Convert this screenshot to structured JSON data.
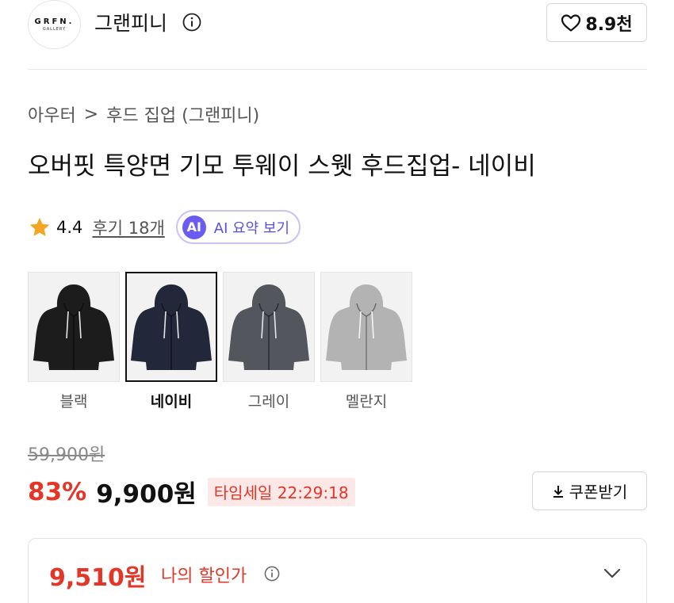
{
  "brand": {
    "logo_line1": "GRFN.",
    "logo_line2": "GALLERY",
    "name": "그랜피니",
    "like_count": "8.9천"
  },
  "breadcrumb": {
    "category": "아우터",
    "separator": ">",
    "subcategory": "후드 집업 (그랜피니)"
  },
  "product": {
    "title": "오버핏 특양면 기모 투웨이 스웻 후드집업- 네이비",
    "rating": "4.4",
    "review_link": "후기 18개",
    "ai_badge": "AI",
    "ai_button": "AI 요약 보기"
  },
  "colors": [
    {
      "label": "블랙",
      "fill": "#1c1c1c",
      "selected": false
    },
    {
      "label": "네이비",
      "fill": "#22283a",
      "selected": true
    },
    {
      "label": "그레이",
      "fill": "#53565c",
      "selected": false
    },
    {
      "label": "멜란지",
      "fill": "#b3b3b3",
      "selected": false
    }
  ],
  "pricing": {
    "original_price": "59,900원",
    "discount_rate": "83%",
    "sale_price": "9,900원",
    "timesale": "타임세일 22:29:18",
    "coupon_button": "쿠폰받기",
    "my_price": "9,510원",
    "my_price_label": "나의 할인가"
  },
  "theme": {
    "accent_red": "#e53527",
    "ai_purple": "#6a5cf0",
    "star": "#f5a524"
  }
}
